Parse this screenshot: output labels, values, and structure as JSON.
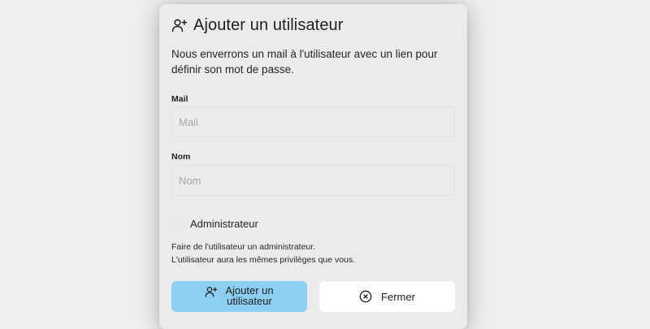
{
  "dialog": {
    "title": "Ajouter un utilisateur",
    "title_icon": "user-plus-icon",
    "description": "Nous enverrons un mail à l'utilisateur avec un lien pour définir son mot de passe."
  },
  "form": {
    "mail": {
      "label": "Mail",
      "placeholder": "Mail",
      "value": ""
    },
    "name": {
      "label": "Nom",
      "placeholder": "Nom",
      "value": ""
    },
    "admin": {
      "label": "Administrateur",
      "checked": false,
      "help_line1": "Faire de l'utilisateur un administrateur.",
      "help_line2": "L'utilisateur aura les mêmes privilèges que vous."
    }
  },
  "actions": {
    "add": {
      "label": "Ajouter un utilisateur",
      "icon": "user-plus-icon",
      "color": "#8ccff0"
    },
    "close": {
      "label": "Fermer",
      "icon": "circle-x-icon",
      "color": "#ffffff"
    }
  },
  "colors": {
    "background": "#efefef",
    "dialog": "#ebebeb",
    "primary": "#8ccff0",
    "text": "#1f1f1f"
  }
}
